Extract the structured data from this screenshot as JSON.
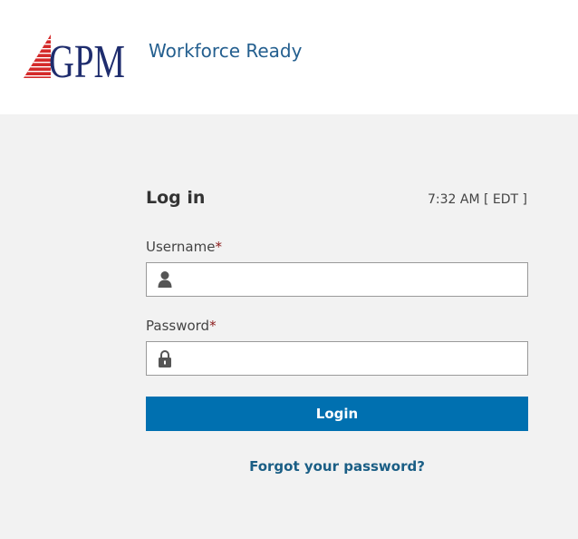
{
  "header": {
    "logo_text": "GPM",
    "app_name": "Workforce Ready"
  },
  "login": {
    "heading": "Log in",
    "time": "7:32 AM [ EDT ]",
    "username": {
      "label": "Username",
      "required_mark": "*",
      "value": "",
      "placeholder": "",
      "icon": "user-icon"
    },
    "password": {
      "label": "Password",
      "required_mark": "*",
      "value": "",
      "placeholder": "",
      "icon": "lock-icon"
    },
    "submit_label": "Login",
    "forgot_label": "Forgot your password?"
  },
  "colors": {
    "header_bg": "#ffffff",
    "content_bg": "#f2f2f2",
    "accent": "#0070b0",
    "app_name": "#245f8f",
    "required": "#8b1a1a",
    "logo_red": "#d42a2a",
    "logo_navy": "#1f2d6e"
  }
}
